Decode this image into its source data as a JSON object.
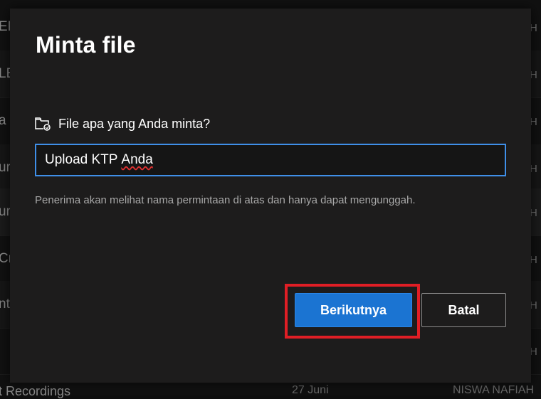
{
  "background": {
    "rows_left": [
      "ER",
      "LE",
      "a",
      "ur",
      "ur",
      "Cr",
      "nt",
      ""
    ],
    "rows_right": [
      "H",
      "H",
      "H",
      "H",
      "H",
      "H",
      "H",
      "H"
    ],
    "bottom_row": {
      "name": "t Recordings",
      "date": "27 Juni",
      "owner": "NISWA NAFIAH"
    }
  },
  "dialog": {
    "title": "Minta file",
    "field_label": "File apa yang Anda minta?",
    "input": {
      "value_plain": "Upload KTP ",
      "value_flagged": "Anda"
    },
    "helper": "Penerima akan melihat nama permintaan di atas dan hanya dapat mengunggah.",
    "buttons": {
      "next": "Berikutnya",
      "cancel": "Batal"
    },
    "accent_color": "#1b74d2",
    "highlight_color": "#e01e25"
  }
}
